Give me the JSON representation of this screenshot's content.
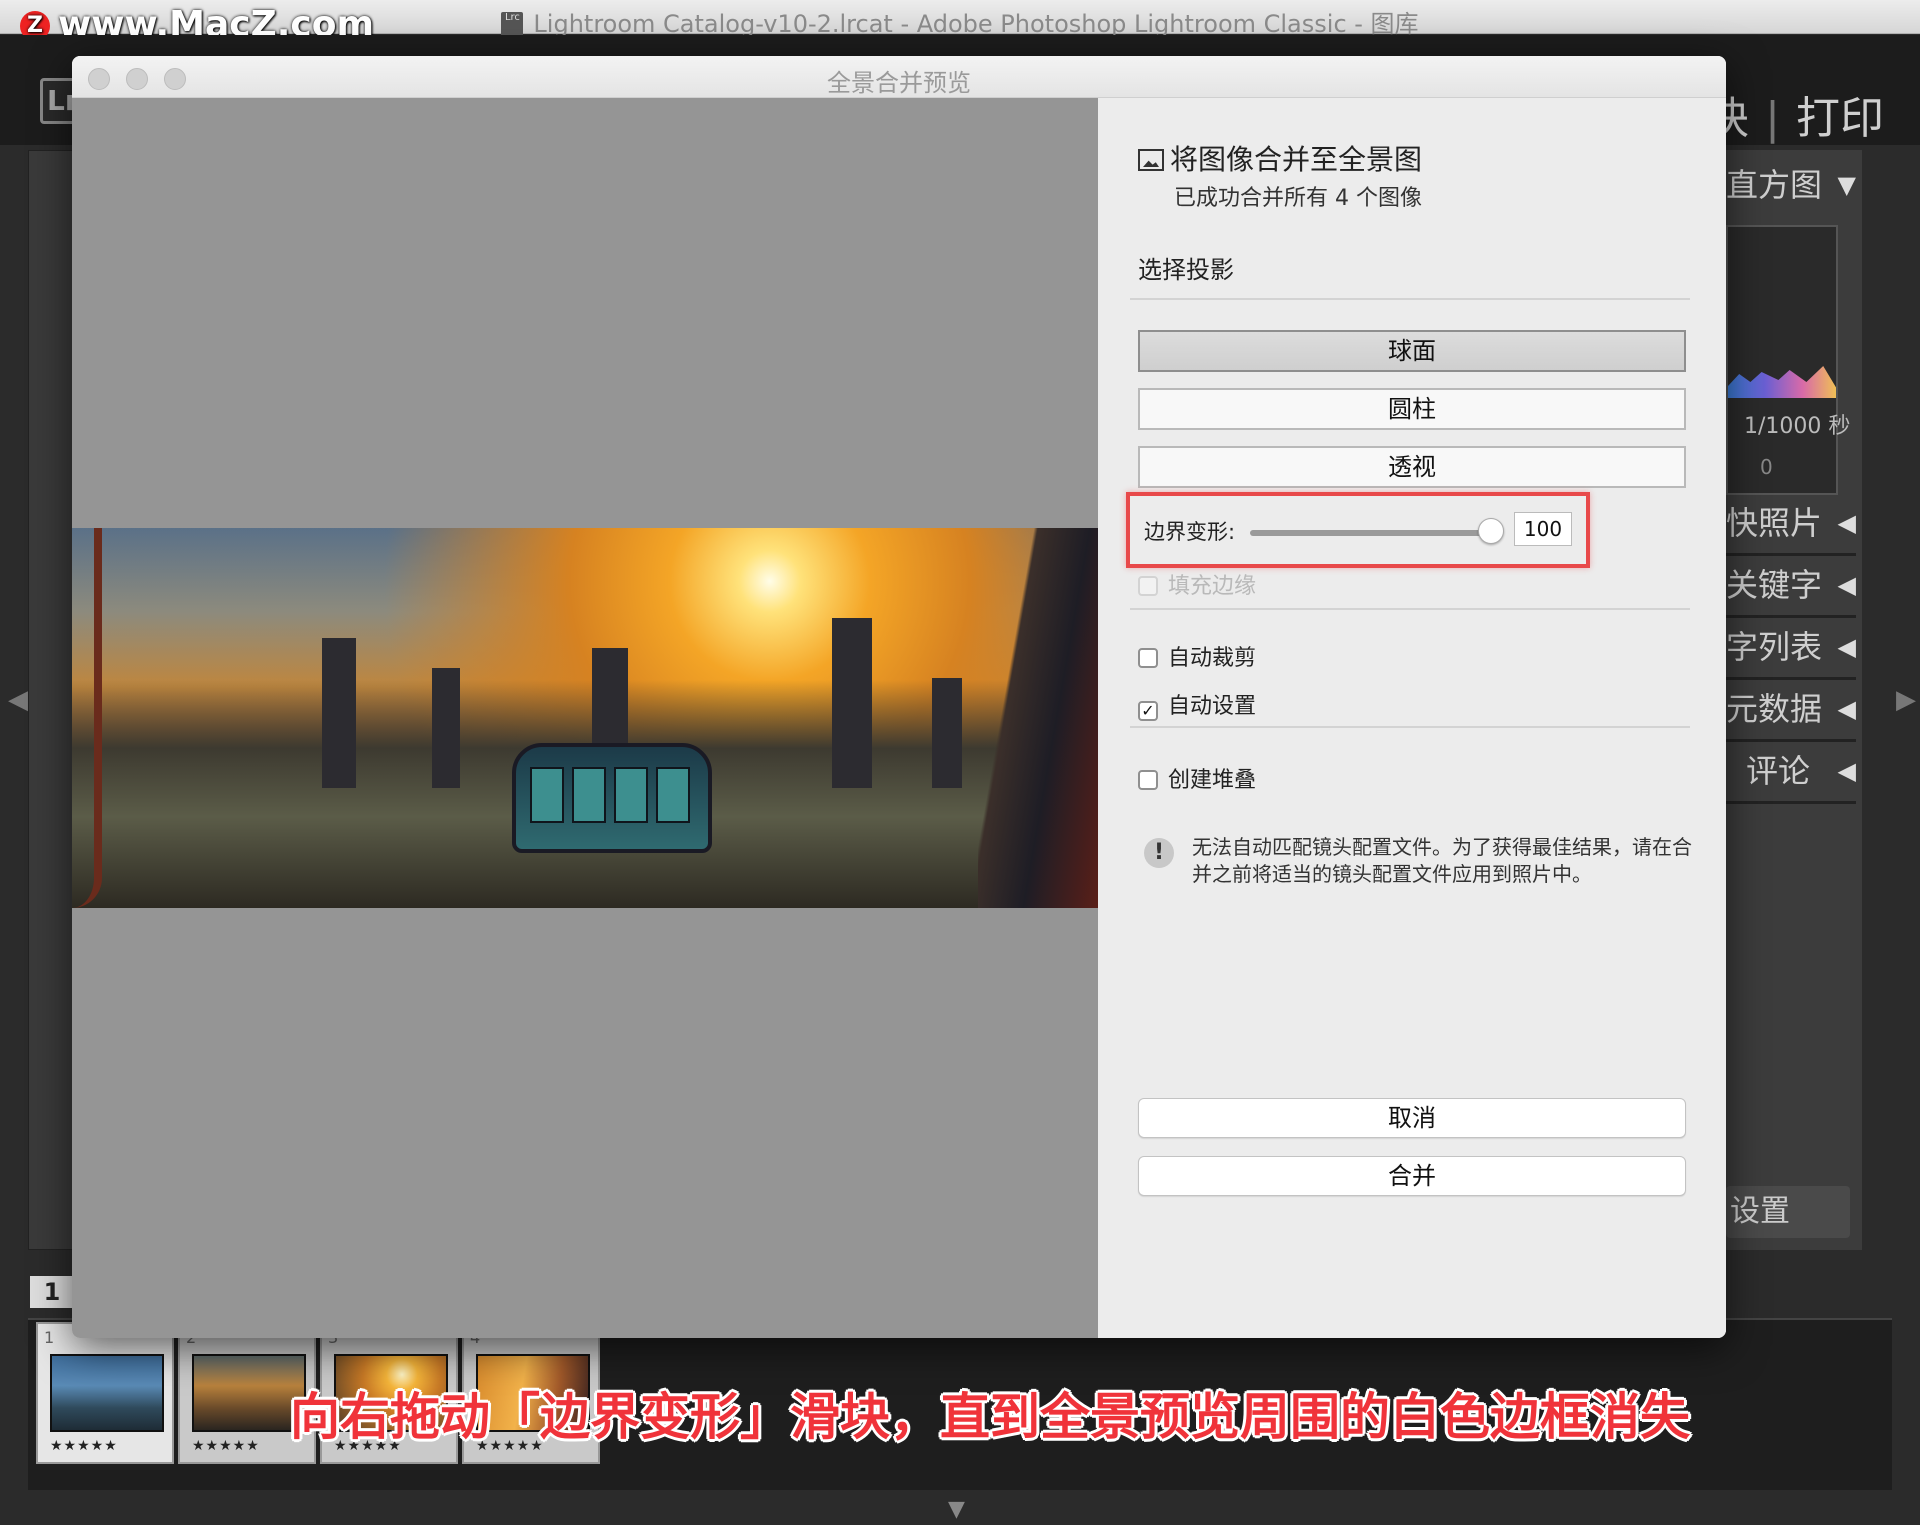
{
  "watermark": {
    "logo": "Z",
    "text": "www.MacZ.com"
  },
  "window": {
    "title": "Lightroom Catalog-v10-2.lrcat - Adobe Photoshop Lightroom Classic - 图库",
    "app_icon_text": "Lrc"
  },
  "lightroom": {
    "logo": "Lr",
    "module_nav": {
      "partial": "块",
      "separator": "|",
      "print": "打印"
    },
    "right_panel": {
      "histogram": "直方图",
      "shutter": "1/1000 秒",
      "zero": "0",
      "quick_develop": "快照片",
      "keywording": "关键字",
      "keyword_list": "字列表",
      "metadata": "元数据",
      "comments": "评论",
      "sync_settings": "设置"
    },
    "arrow_down": "▼",
    "arrow_left": "◀",
    "filmstrip": {
      "page": "1",
      "items": [
        {
          "num": "1",
          "stars": "★★★★★"
        },
        {
          "num": "2",
          "stars": "★★★★★"
        },
        {
          "num": "3",
          "stars": "★★★★★"
        },
        {
          "num": "4",
          "stars": "★★★★★"
        }
      ]
    }
  },
  "dialog": {
    "title": "全景合并预览",
    "heading": "将图像合并至全景图",
    "subheading": "已成功合并所有 4 个图像",
    "projection_label": "选择投影",
    "projections": [
      {
        "label": "球面",
        "selected": true
      },
      {
        "label": "圆柱",
        "selected": false
      },
      {
        "label": "透视",
        "selected": false
      }
    ],
    "boundary_warp": {
      "label": "边界变形:",
      "value": "100",
      "percent": 100
    },
    "fill_edges": {
      "label": "填充边缘",
      "checked": false,
      "enabled": false
    },
    "auto_crop": {
      "label": "自动裁剪",
      "checked": false
    },
    "auto_settings": {
      "label": "自动设置",
      "checked": true
    },
    "create_stack": {
      "label": "创建堆叠",
      "checked": false
    },
    "warning_icon": "!",
    "warning": "无法自动匹配镜头配置文件。为了获得最佳结果，请在合并之前将适当的镜头配置文件应用到照片中。",
    "cancel": "取消",
    "merge": "合并"
  },
  "caption": "向右拖动「边界变形」滑块，直到全景预览周围的白色边框消失",
  "colors": {
    "highlight": "#e8494a",
    "caption": "#f0333a",
    "preview_bg": "#959595"
  }
}
